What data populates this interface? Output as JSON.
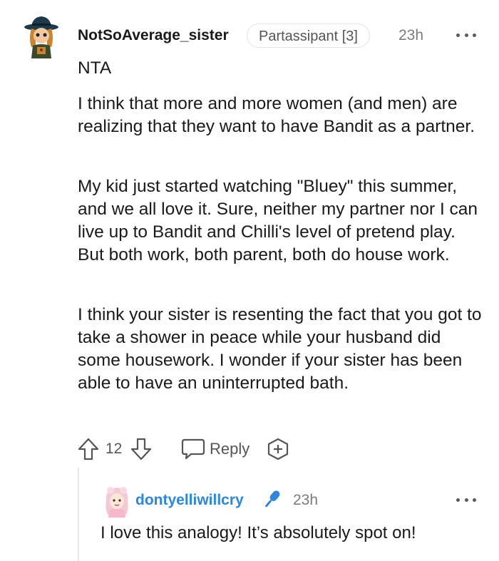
{
  "comment": {
    "username": "NotSoAverage_sister",
    "flair": "Partassipant [3]",
    "time": "23h",
    "body": {
      "verdict": "NTA",
      "paragraph1": "I think that more and more women (and men) are realizing that they want to have Bandit as a partner.",
      "paragraph2": "My kid just started watching \"Bluey\" this summer, and we all love it. Sure, neither my partner nor I can live up to Bandit and Chilli's level of pretend play. But both work, both parent, both do house work.",
      "paragraph3": "I think your sister is resenting the fact that you got to take a shower in peace while your husband did some housework. I wonder if your sister has been able to have an uninterrupted bath."
    },
    "actions": {
      "upvote_icon": "upvote-arrow-icon",
      "vote_count": "12",
      "downvote_icon": "downvote-arrow-icon",
      "reply_icon": "speech-bubble-icon",
      "reply_label": "Reply",
      "award_icon": "add-award-icon"
    }
  },
  "reply": {
    "username": "dontyelliwillcry",
    "badge_icon": "microphone-icon",
    "time": "23h",
    "body": "I love this analogy! It’s absolutely spot on!"
  },
  "colors": {
    "text": "#1a1a1b",
    "muted": "#7c7c7c",
    "reply_username": "#2e86de",
    "badge_blue": "#2e86de"
  }
}
